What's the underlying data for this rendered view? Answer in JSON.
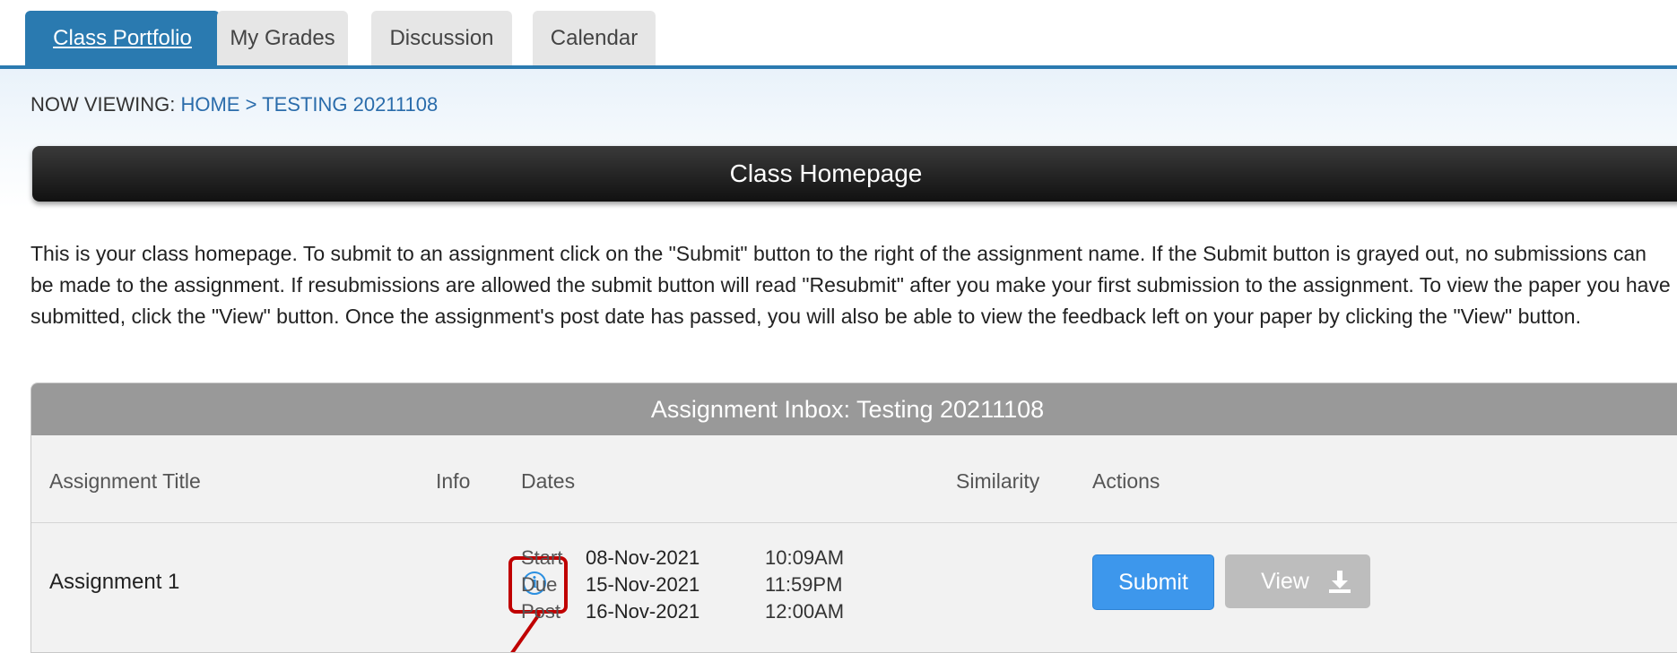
{
  "tabs": [
    "Class Portfolio",
    "My Grades",
    "Discussion",
    "Calendar"
  ],
  "breadcrumb": {
    "prefix": "NOW VIEWING:",
    "home": "HOME",
    "separator": ">",
    "current": "TESTING 20211108"
  },
  "homepage_bar": {
    "title": "Class Homepage"
  },
  "intro_text": "This is your class homepage. To submit to an assignment click on the \"Submit\" button to the right of the assignment name. If the Submit button is grayed out, no submissions can be made to the assignment. If resubmissions are allowed the submit button will read \"Resubmit\" after you make your first submission to the assignment. To view the paper you have submitted, click the \"View\" button. Once the assignment's post date has passed, you will also be able to view the feedback left on your paper by clicking the \"View\" button.",
  "inbox": {
    "title": "Assignment Inbox: Testing 20211108",
    "columns": {
      "title": "Assignment Title",
      "info": "Info",
      "dates": "Dates",
      "similarity": "Similarity",
      "actions": "Actions"
    },
    "rows": [
      {
        "title": "Assignment 1",
        "info_icon": "info-icon",
        "start_label": "Start",
        "start_date": "08-Nov-2021",
        "start_time": "10:09AM",
        "due_label": "Due",
        "due_date": "15-Nov-2021",
        "due_time": "11:59PM",
        "post_label": "Post",
        "post_date": "16-Nov-2021",
        "post_time": "12:00AM",
        "submit_label": "Submit",
        "view_label": "View",
        "download_icon": "download-icon"
      }
    ]
  },
  "colors": {
    "tab_active": "#2a7ab0",
    "submit_button": "#3d97ec",
    "highlight": "#c00000"
  }
}
